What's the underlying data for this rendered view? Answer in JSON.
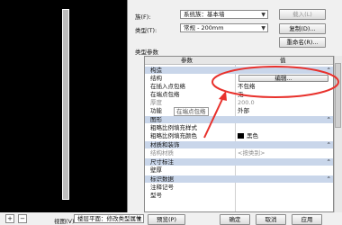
{
  "type_props": {
    "family_label": "族(F):",
    "family_value": "系统族：基本墙",
    "type_label": "类型(T):",
    "type_value": "常规 - 200mm",
    "load_button": "载入(L)",
    "duplicate_button": "复制(D)...",
    "rename_button": "重命名(R)...",
    "params_title": "类型参数"
  },
  "grid": {
    "col_param": "参数",
    "col_value": "值",
    "rows": [
      {
        "kind": "group",
        "param": "构造",
        "value": ""
      },
      {
        "kind": "row",
        "param": "结构",
        "value": "编辑..."
      },
      {
        "kind": "row",
        "param": "在插入点包络",
        "value": "不包络"
      },
      {
        "kind": "row",
        "param": "在端点包络",
        "value": "无"
      },
      {
        "kind": "row",
        "param": "厚度",
        "value": "200.0"
      },
      {
        "kind": "row",
        "param": "功能",
        "value": "外部"
      },
      {
        "kind": "group",
        "param": "图形",
        "value": ""
      },
      {
        "kind": "row",
        "param": "粗略比例填充样式",
        "value": ""
      },
      {
        "kind": "row",
        "param": "粗略比例填充颜色",
        "value": "黑色"
      },
      {
        "kind": "group",
        "param": "材质和装饰",
        "value": ""
      },
      {
        "kind": "row",
        "param": "结构材质",
        "value": "<按类别>"
      },
      {
        "kind": "group",
        "param": "尺寸标注",
        "value": ""
      },
      {
        "kind": "row",
        "param": "壁厚",
        "value": ""
      },
      {
        "kind": "group",
        "param": "标识数据",
        "value": ""
      },
      {
        "kind": "row",
        "param": "注释记号",
        "value": ""
      },
      {
        "kind": "row",
        "param": "型号",
        "value": ""
      }
    ],
    "tooltip": "在端点包络"
  },
  "bottom": {
    "view_label": "视图(V):",
    "view_value": "楼层平面：修改类型属性",
    "preview_button": "预览(P)",
    "ok_button": "确定",
    "cancel_button": "取消",
    "apply_button": "应用"
  },
  "colors": {
    "annotation": "#e8312c",
    "group_row": "#c9d6ea"
  }
}
